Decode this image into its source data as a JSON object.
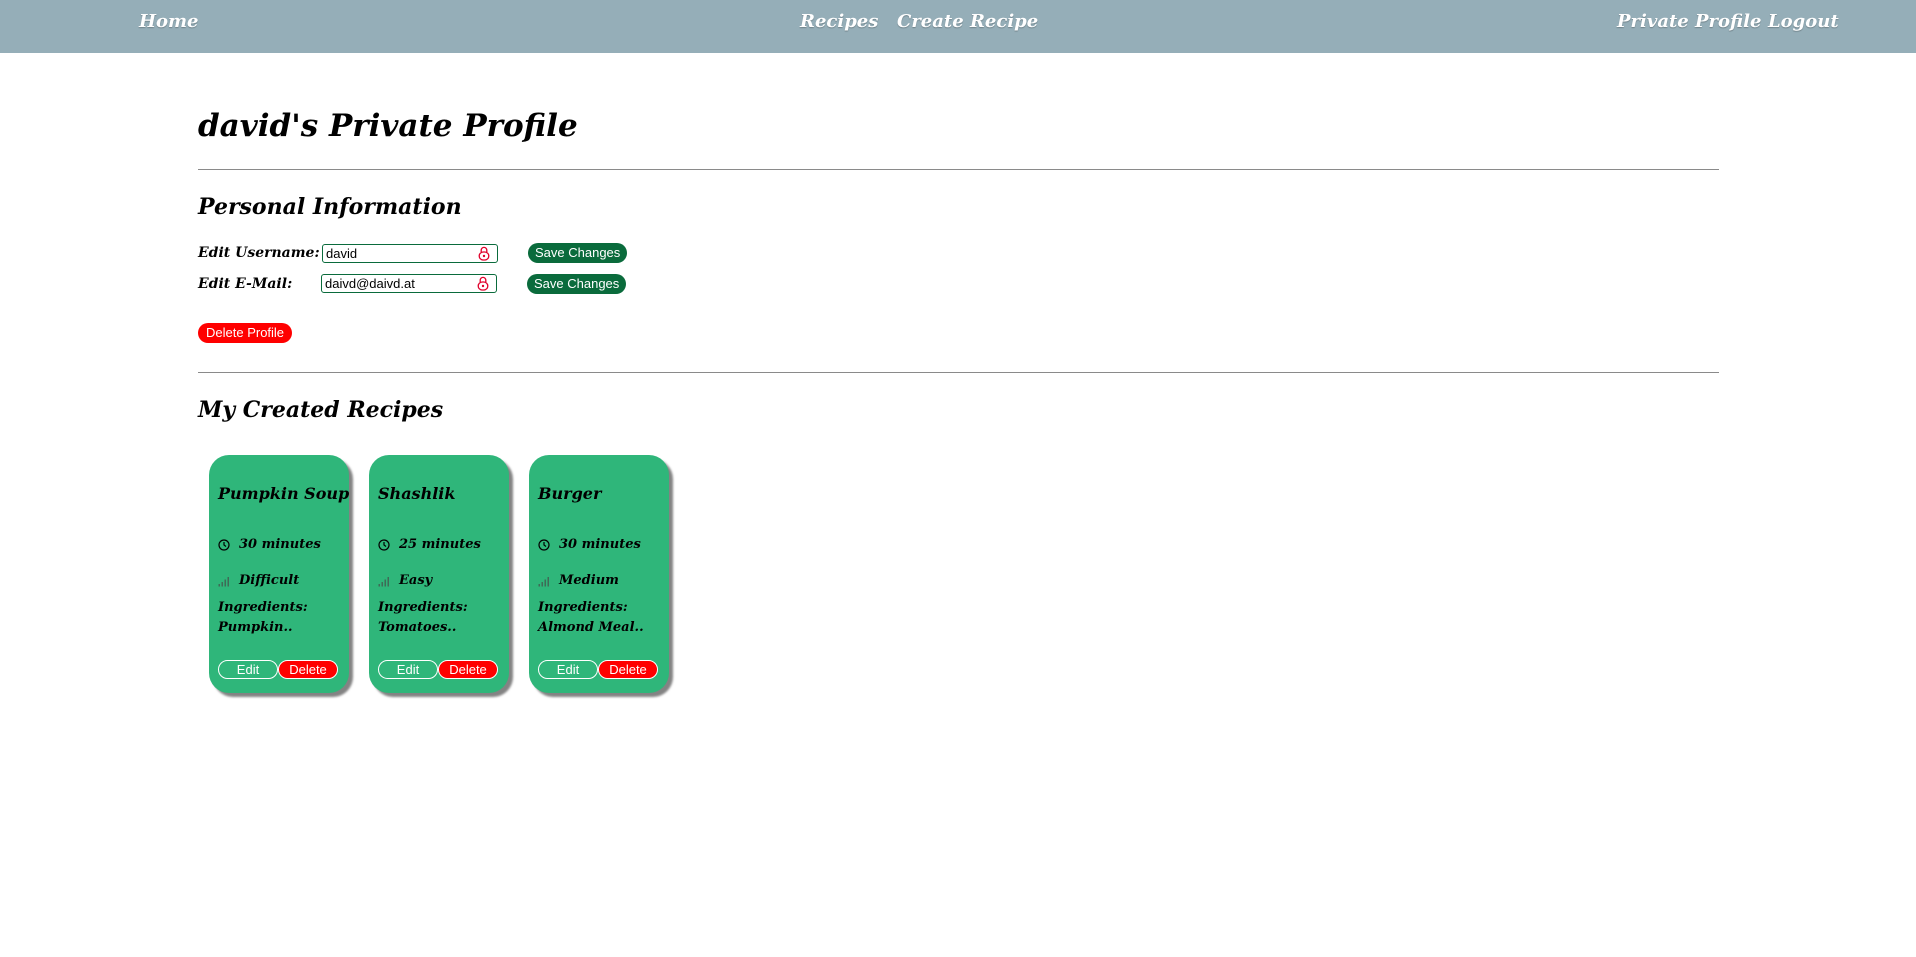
{
  "nav": {
    "home": "Home",
    "recipes": "Recipes",
    "create_recipe": "Create Recipe",
    "private_profile": "Private Profile",
    "logout": "Logout"
  },
  "page": {
    "title": "david's Private Profile"
  },
  "personal_info": {
    "heading": "Personal Information",
    "username_label": "Edit Username:",
    "username_value": "david",
    "email_label": "Edit E-Mail:",
    "email_value": "daivd@daivd.at",
    "save_label": "Save Changes",
    "delete_profile_label": "Delete Profile",
    "lock_icon": "lock-icon"
  },
  "recipes_section": {
    "heading": "My Created Recipes",
    "edit_label": "Edit",
    "delete_label": "Delete",
    "time_icon": "clock-icon",
    "difficulty_icon": "signal-bars-icon",
    "cards": [
      {
        "title": "Pumpkin Soup",
        "time": "30 minutes",
        "difficulty": "Difficult",
        "ingredients_label": "Ingredients:",
        "ingredients_preview": "Pumpkin.."
      },
      {
        "title": "Shashlik",
        "time": "25 minutes",
        "difficulty": "Easy",
        "ingredients_label": "Ingredients:",
        "ingredients_preview": "Tomatoes.."
      },
      {
        "title": "Burger",
        "time": "30 minutes",
        "difficulty": "Medium",
        "ingredients_label": "Ingredients:",
        "ingredients_preview": "Almond Meal.."
      }
    ]
  },
  "colors": {
    "navbar": "#95aeb8",
    "card": "#2fb67a",
    "save_button": "#0a6b3c",
    "danger": "#ff0000"
  }
}
